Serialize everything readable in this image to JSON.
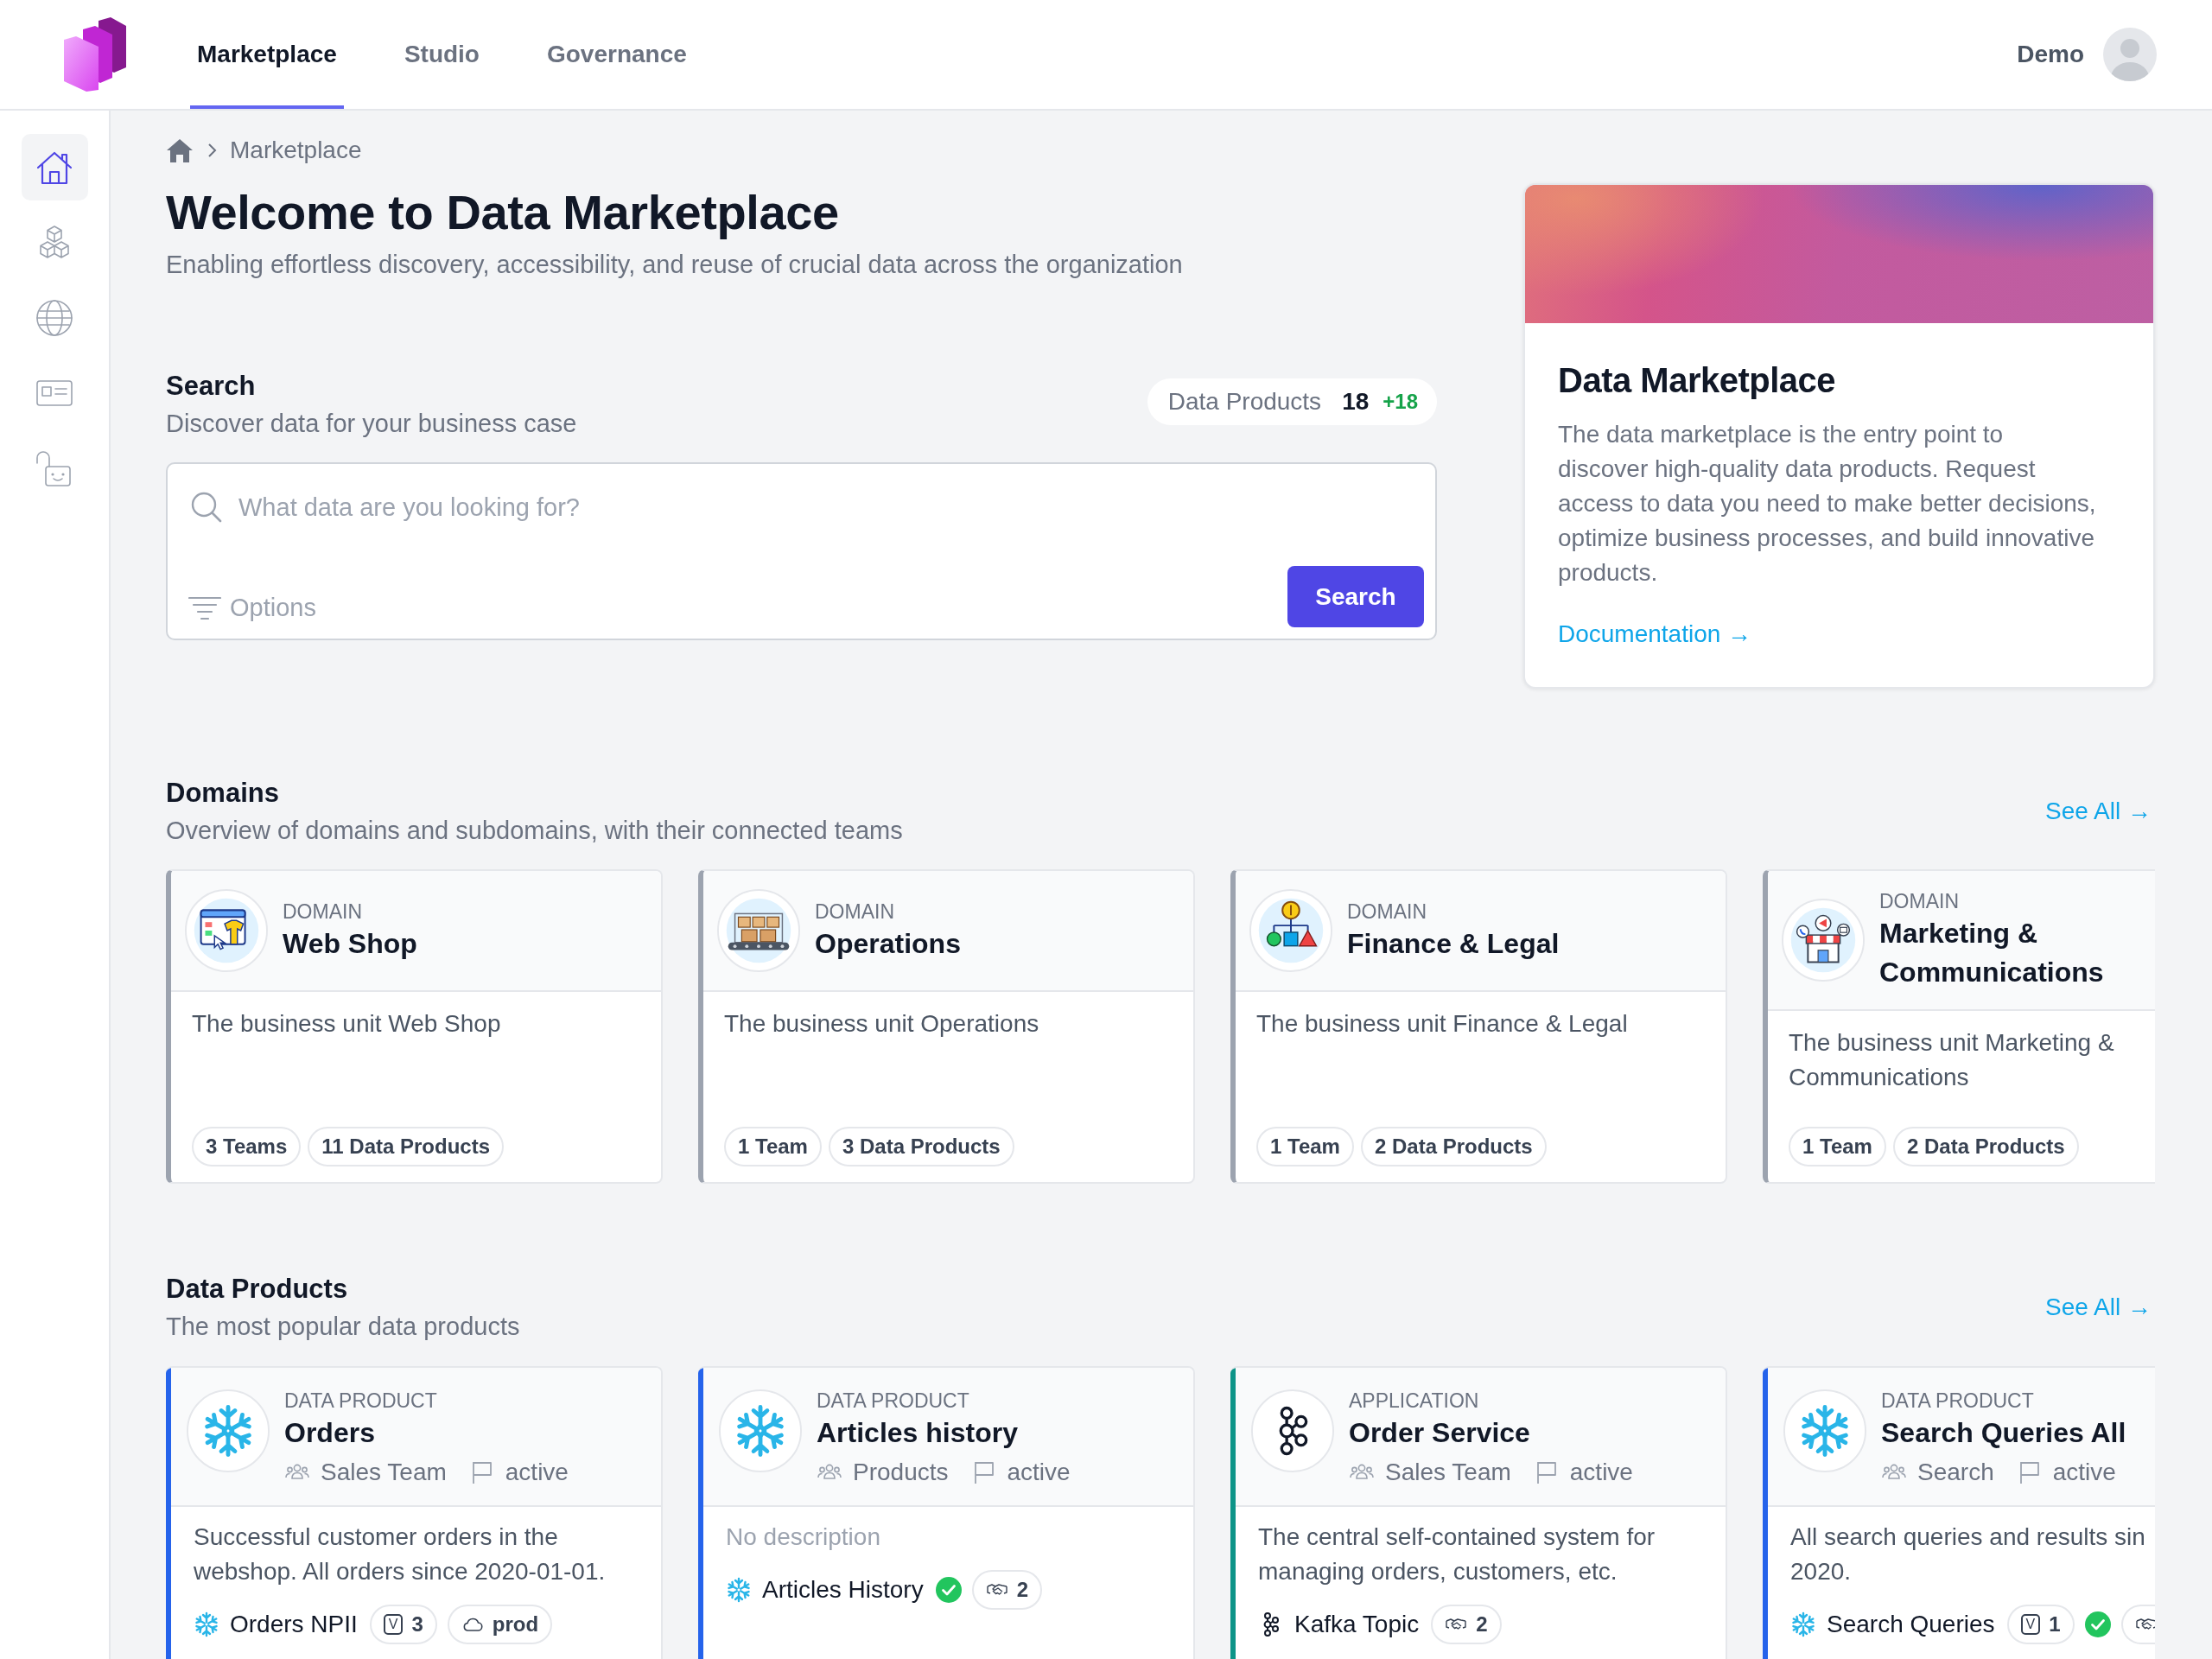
{
  "topbar": {
    "tabs": [
      {
        "label": "Marketplace",
        "selected": true
      },
      {
        "label": "Studio",
        "selected": false
      },
      {
        "label": "Governance",
        "selected": false
      }
    ],
    "user": {
      "name": "Demo"
    }
  },
  "sidebar": {
    "items": [
      {
        "kind": "home",
        "selected": true
      },
      {
        "kind": "cubes",
        "selected": false
      },
      {
        "kind": "globe",
        "selected": false
      },
      {
        "kind": "card",
        "selected": false
      },
      {
        "kind": "access",
        "selected": false
      }
    ]
  },
  "breadcrumb": [
    "Marketplace"
  ],
  "page": {
    "title": "Welcome to Data Marketplace",
    "subtitle": "Enabling effortless discovery, accessibility, and reuse of crucial data across the organization"
  },
  "search": {
    "title": "Search",
    "subtitle": "Discover data for your business case",
    "counter": {
      "label": "Data Products",
      "count": "18",
      "change": "+18"
    },
    "placeholder": "What data are you looking for?",
    "options": "Options",
    "button": "Search"
  },
  "info_card": {
    "title": "Data Marketplace",
    "text": "The data marketplace is the entry point to discover high-quality data products. Request access to data you need to make better decisions, optimize business processes, and build innovative products.",
    "link": "Documentation →"
  },
  "domains": {
    "title": "Domains",
    "subtitle": "Overview of domains and subdomains, with their connected teams",
    "see_all": "See All →",
    "cards": [
      {
        "kind": "shop",
        "type_label": "DOMAIN",
        "name": "Web Shop",
        "description": "The business unit Web Shop",
        "tags": [
          "3 Teams",
          "11 Data Products"
        ]
      },
      {
        "kind": "operations",
        "type_label": "DOMAIN",
        "name": "Operations",
        "description": "The business unit Operations",
        "tags": [
          "1 Team",
          "3 Data Products"
        ]
      },
      {
        "kind": "finance",
        "type_label": "DOMAIN",
        "name": "Finance & Legal",
        "description": "The business unit Finance & Legal",
        "tags": [
          "1 Team",
          "2 Data Products"
        ]
      },
      {
        "kind": "marketing",
        "type_label": "DOMAIN",
        "name": "Marketing & Communications",
        "description": "The business unit Marketing & Communications",
        "tags": [
          "1 Team",
          "2 Data Products"
        ]
      }
    ]
  },
  "data_products": {
    "title": "Data Products",
    "subtitle": "The most popular data products",
    "see_all": "See All →",
    "cards": [
      {
        "kind": "snowflake",
        "color": "#2563eb",
        "type_label": "DATA PRODUCT",
        "name": "Orders",
        "team": "Sales Team",
        "status": "active",
        "description": "Successful customer orders in the webshop. All orders since 2020-01-01.",
        "has_description": true,
        "outputs": [
          {
            "kind": "snowflake",
            "name": "Orders NPII",
            "badges": [
              {
                "kind": "version",
                "icon_text": "V",
                "text": "3"
              },
              {
                "kind": "environment",
                "text": "prod"
              }
            ]
          }
        ]
      },
      {
        "kind": "snowflake",
        "color": "#2563eb",
        "type_label": "DATA PRODUCT",
        "name": "Articles history",
        "team": "Products",
        "status": "active",
        "description": "No description",
        "has_description": false,
        "outputs": [
          {
            "kind": "snowflake",
            "name": "Articles History",
            "badges": [
              {
                "kind": "check"
              },
              {
                "kind": "contracts",
                "text": "2"
              }
            ]
          }
        ]
      },
      {
        "kind": "kafka",
        "color": "#0d9488",
        "type_label": "APPLICATION",
        "name": "Order Service",
        "team": "Sales Team",
        "status": "active",
        "description": "The central self-contained system for managing orders, customers, etc.",
        "has_description": true,
        "outputs": [
          {
            "kind": "kafka",
            "name": "Kafka Topic",
            "badges": [
              {
                "kind": "contracts",
                "text": "2"
              }
            ]
          }
        ]
      },
      {
        "kind": "snowflake",
        "color": "#2563eb",
        "type_label": "DATA PRODUCT",
        "name": "Search Queries All",
        "team": "Search",
        "status": "active",
        "description": "All search queries and results sin 2020.",
        "has_description": true,
        "outputs": [
          {
            "kind": "snowflake",
            "name": "Search Queries",
            "badges": [
              {
                "kind": "version",
                "icon_text": "V",
                "text": "1"
              },
              {
                "kind": "check"
              },
              {
                "kind": "contracts"
              }
            ]
          }
        ]
      }
    ]
  }
}
